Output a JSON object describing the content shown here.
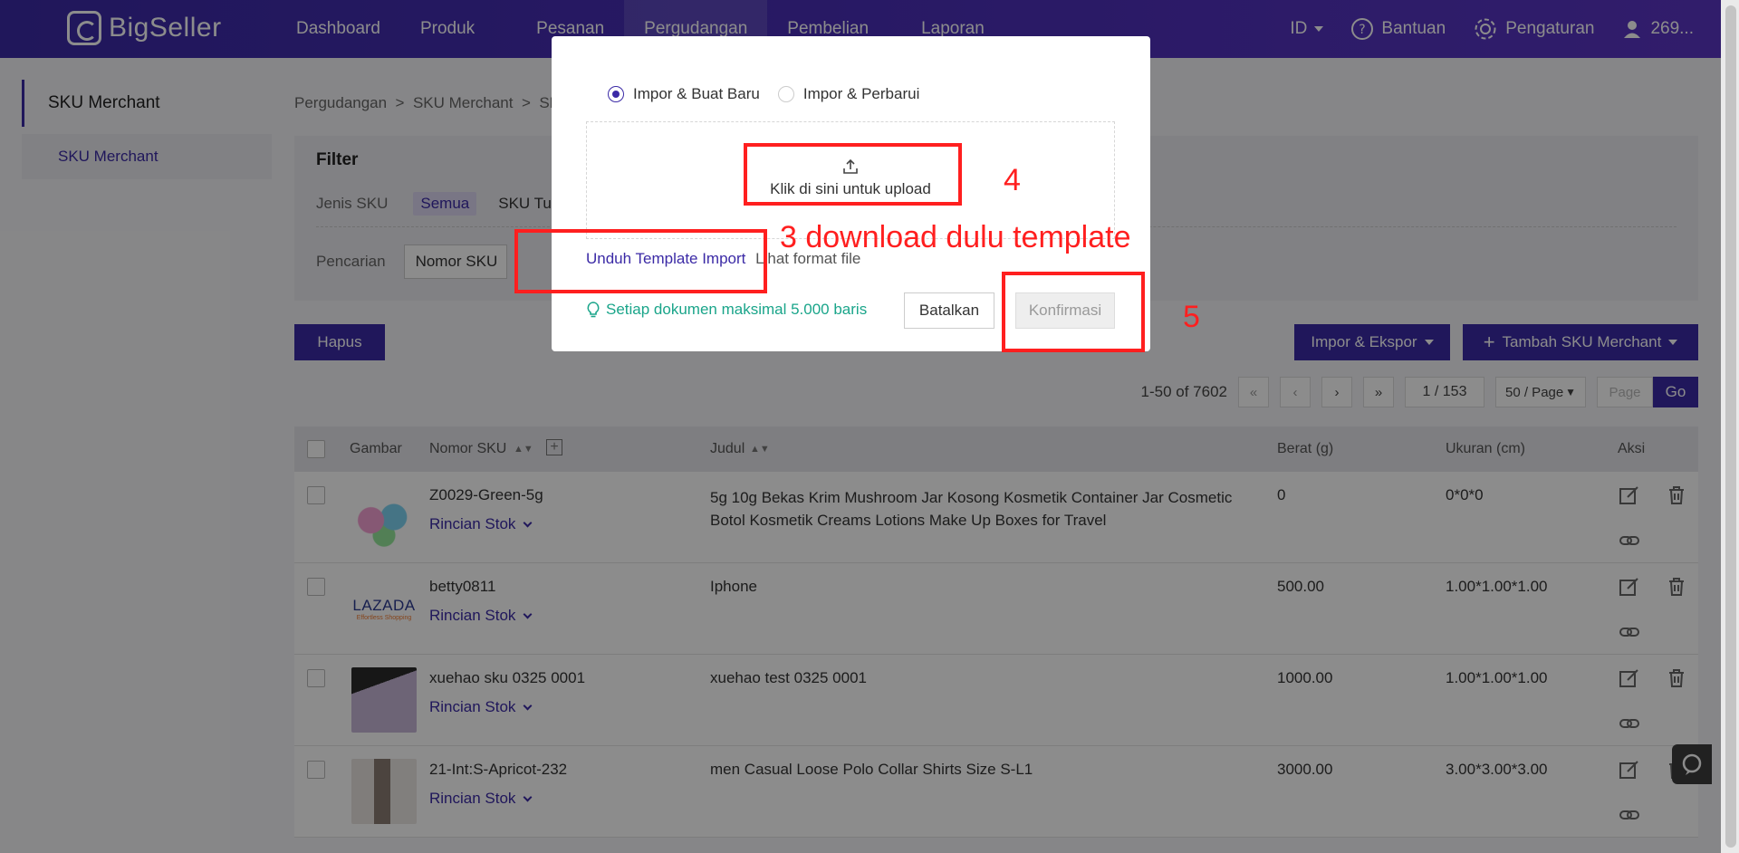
{
  "app": {
    "logo_text": "BigSeller",
    "nav": [
      "Dashboard",
      "Produk",
      "Pesanan",
      "Pergudangan",
      "Pembelian",
      "Laporan"
    ],
    "lang": "ID",
    "help": "Bantuan",
    "settings": "Pengaturan",
    "user": "269..."
  },
  "sidebar": {
    "section": "SKU Merchant",
    "item": "SKU Merchant"
  },
  "breadcrumb": [
    "Pergudangan",
    ">",
    "SKU Merchant",
    ">",
    "SK"
  ],
  "filter": {
    "title": "Filter",
    "jenis_label": "Jenis SKU",
    "jenis_options": [
      "Semua",
      "SKU Tu"
    ],
    "search_label": "Pencarian",
    "search_select": "Nomor SKU"
  },
  "actions": {
    "delete": "Hapus",
    "import_export": "Impor & Ekspor",
    "add": "Tambah SKU Merchant"
  },
  "pager": {
    "range": "1-50 of 7602",
    "page": "1 / 153",
    "per_page": "50 / Page",
    "page_placeholder": "Page",
    "go": "Go"
  },
  "table": {
    "headers": [
      "Gambar",
      "Nomor SKU",
      "Judul",
      "Berat (g)",
      "Ukuran (cm)",
      "Aksi"
    ],
    "stock_link": "Rincian Stok",
    "rows": [
      {
        "sku": "Z0029-Green-5g",
        "title": "5g 10g Bekas Krim Mushroom Jar Kosong Kosmetik Container Jar Cosmetic Botol Kosmetik Creams Lotions Make Up Boxes for Travel",
        "weight": "0",
        "size": "0*0*0",
        "thumb_color": "#c9e6e2"
      },
      {
        "sku": "betty0811",
        "title": "Iphone",
        "weight": "500.00",
        "size": "1.00*1.00*1.00",
        "thumb_text": "LAZADA",
        "thumb_sub": "Effortless Shopping"
      },
      {
        "sku": "xuehao sku 0325 0001",
        "title": "xuehao test 0325 0001",
        "weight": "1000.00",
        "size": "1.00*1.00*1.00",
        "thumb_color": "#b9a7c9"
      },
      {
        "sku": "21-Int:S-Apricot-232",
        "title": "men Casual Loose Polo Collar Shirts Size S-L1",
        "weight": "3000.00",
        "size": "3.00*3.00*3.00",
        "thumb_color": "#d8d1cc"
      }
    ]
  },
  "modal": {
    "radio_new": "Impor & Buat Baru",
    "radio_update": "Impor & Perbarui",
    "upload_text": "Klik di sini untuk upload",
    "template_link": "Unduh Template Import",
    "template_suffix": "Lihat format file",
    "tip": "Setiap dokumen maksimal 5.000 baris",
    "cancel": "Batalkan",
    "confirm": "Konfirmasi"
  },
  "annotations": {
    "step3": "3 download dulu template",
    "step4": "4",
    "step5": "5"
  },
  "colors": {
    "brand": "#3b2aa6",
    "annotation": "#ff1f1f",
    "tip": "#1aa58a"
  }
}
